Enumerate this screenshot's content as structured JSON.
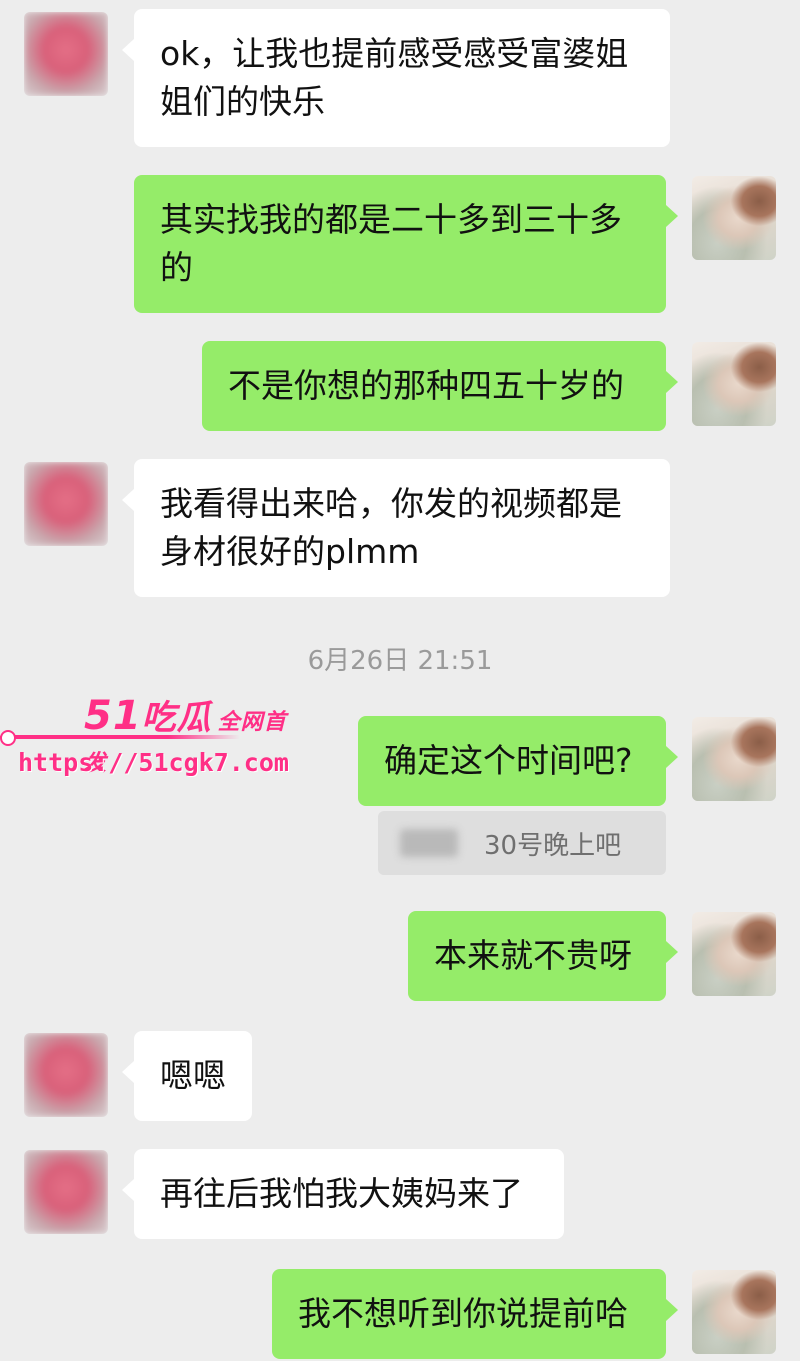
{
  "messages": [
    {
      "text": "ok，让我也提前感受感受富婆姐姐们的快乐"
    },
    {
      "text": "其实找我的都是二十多到三十多的"
    },
    {
      "text": "不是你想的那种四五十岁的"
    },
    {
      "text": "我看得出来哈，你发的视频都是身材很好的plmm"
    },
    {
      "text": "确定这个时间吧?"
    },
    {
      "text": "本来就不贵呀"
    },
    {
      "text": "嗯嗯"
    },
    {
      "text": "再往后我怕我大姨妈来了"
    },
    {
      "text": "我不想听到你说提前哈"
    }
  ],
  "timestamp": "6月26日 21:51",
  "quote": {
    "text": "30号晚上吧"
  },
  "watermark": {
    "logo_num": "51",
    "logo_text": "吃瓜",
    "logo_sub": "全网首发",
    "url": "https://51cgk7.com"
  },
  "colors": {
    "background": "#ededed",
    "outgoing_bubble": "#95ec69",
    "incoming_bubble": "#ffffff",
    "watermark": "#ff2f86"
  }
}
